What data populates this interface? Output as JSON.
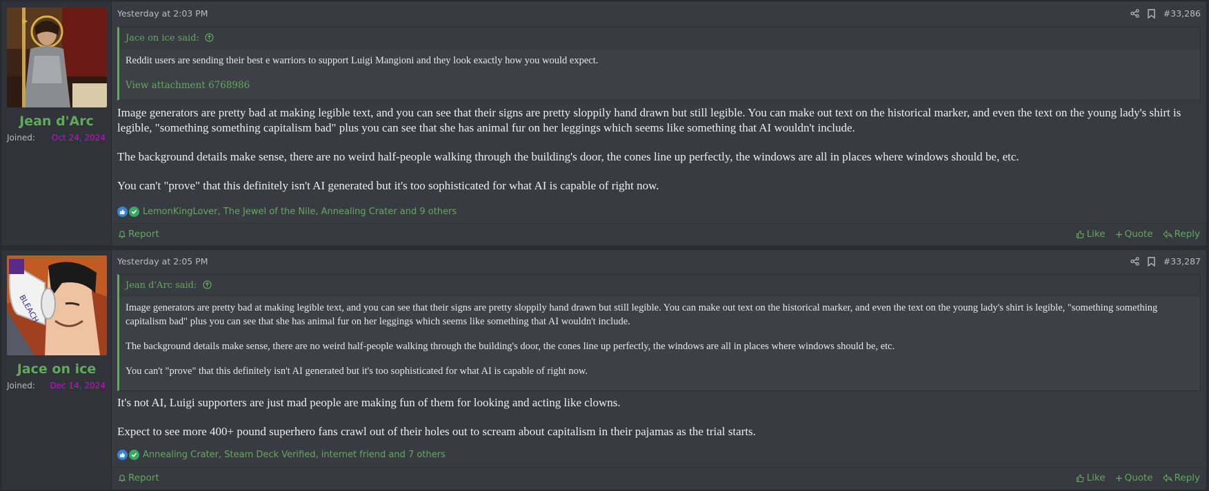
{
  "posts": [
    {
      "username": "Jean d'Arc",
      "joined_label": "Joined:",
      "joined_date": "Oct 24, 2024",
      "avatar_icon": "painting-of-armored-saint-avatar",
      "date": "Yesterday at 2:03 PM",
      "number": "#33,286",
      "quote": {
        "author_said": "Jace on ice said:",
        "paragraphs": [
          "Reddit users are sending their best e warriors to support Luigi Mangioni and they look exactly how you would expect."
        ],
        "attachment_link": "View attachment 6768986"
      },
      "message": [
        "Image generators are pretty bad at making legible text, and you can see that their signs are pretty sloppily hand drawn but still legible. You can make out text on the historical marker, and even the text on the young lady's shirt is legible, \"something something capitalism bad\" plus you can see that she has animal fur on her leggings which seems like something that AI wouldn't include.",
        "The background details make sense, there are no weird half-people walking through the building's door, the cones line up perfectly, the windows are all in places where windows should be, etc.",
        "You can't \"prove\" that this definitely isn't AI generated but it's too sophisticated for what AI is capable of right now."
      ],
      "reactions": "LemonKingLover, The Jewel of the Nile, Annealing Crater and 9 others"
    },
    {
      "username": "Jace on ice",
      "joined_label": "Joined:",
      "joined_date": "Dec 14, 2024",
      "avatar_icon": "cartoon-man-drinking-bleach-avatar",
      "date": "Yesterday at 2:05 PM",
      "number": "#33,287",
      "quote": {
        "author_said": "Jean d'Arc said:",
        "paragraphs": [
          "Image generators are pretty bad at making legible text, and you can see that their signs are pretty sloppily hand drawn but still legible. You can make out text on the historical marker, and even the text on the young lady's shirt is legible, \"something something capitalism bad\" plus you can see that she has animal fur on her leggings which seems like something that AI wouldn't include.",
          "The background details make sense, there are no weird half-people walking through the building's door, the cones line up perfectly, the windows are all in places where windows should be, etc.",
          "You can't \"prove\" that this definitely isn't AI generated but it's too sophisticated for what AI is capable of right now."
        ]
      },
      "message": [
        "It's not AI, Luigi supporters are just mad people are making fun of them for looking and acting like clowns.",
        "Expect to see more 400+ pound superhero fans crawl out of their holes out to scream about capitalism in their pajamas as the trial starts."
      ],
      "reactions": "Annealing Crater, Steam Deck Verified, internet friend and 7 others"
    }
  ],
  "actions": {
    "report": "Report",
    "like": "Like",
    "quote": "Quote",
    "reply": "Reply"
  },
  "colors": {
    "accent": "#63a95c",
    "joined_date": "#e000d8",
    "background": "#383c42"
  }
}
